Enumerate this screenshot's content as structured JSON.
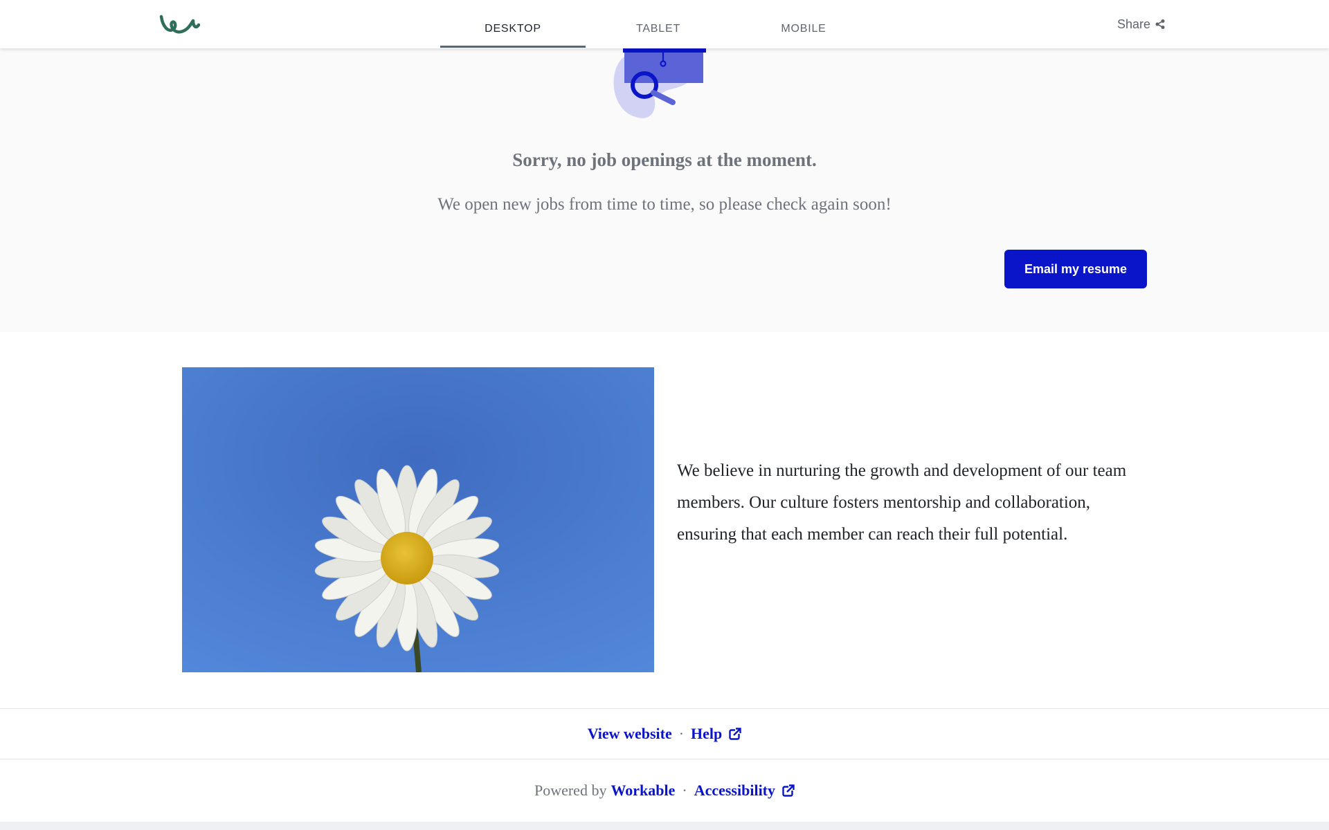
{
  "header": {
    "tabs": [
      {
        "label": "DESKTOP",
        "active": true
      },
      {
        "label": "TABLET",
        "active": false
      },
      {
        "label": "MOBILE",
        "active": false
      }
    ],
    "share_label": "Share",
    "logo_icon": "workable-logo-icon",
    "share_icon": "share-icon"
  },
  "hero": {
    "illustration_icon": "graduation-cap-magnifier-icon",
    "headline": "Sorry, no job openings at the moment.",
    "subline": "We open new jobs from time to time, so please check again soon!",
    "email_button_label": "Email my resume"
  },
  "culture": {
    "image": "daisy-against-blue-sky",
    "text": "We believe in nurturing the growth and development of our team members. Our culture fosters mentorship and collaboration, ensuring that each member can reach their full potential."
  },
  "footer": {
    "view_website_label": "View website",
    "separator": "·",
    "help_label": "Help",
    "powered_by_label": "Powered by",
    "workable_label": "Workable",
    "accessibility_label": "Accessibility",
    "external_link_icon": "external-link-icon"
  },
  "colors": {
    "accent": "#0a14c8",
    "logo": "#2f6e5a",
    "hero_background": "#fafafa",
    "muted_text": "#6e727a"
  }
}
